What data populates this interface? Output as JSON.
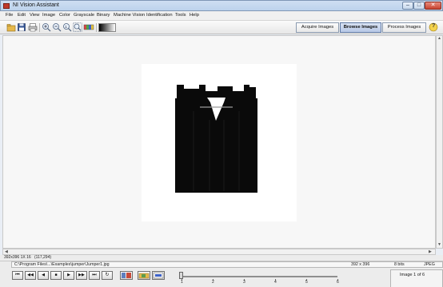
{
  "window": {
    "title": "NI Vision Assistant"
  },
  "menu": [
    "File",
    "Edit",
    "View",
    "Image",
    "Color",
    "Grayscale",
    "Binary",
    "Machine Vision",
    "Identification",
    "Tools",
    "Help"
  ],
  "tabs": {
    "acquire": "Acquire Images",
    "browse": "Browse Images",
    "process": "Process Images"
  },
  "toolbar": {
    "help_icon": "?"
  },
  "status": {
    "dims": "392x396 1X 16",
    "coords": "(117,294)"
  },
  "file": {
    "path": "C:\\Program Files\\...\\Examples\\jumper\\Jumper1.jpg",
    "dimensions": "392 x 396",
    "depth": "8 bits",
    "format": "JPEG",
    "page": "Image 1 of 6"
  },
  "player": {
    "first": "⏮",
    "rew": "◀◀",
    "prev": "◀",
    "stop": "■",
    "next": "▶",
    "ff": "▶▶",
    "last": "⏭",
    "loop": "↻"
  },
  "slider": {
    "value": 1,
    "ticks": [
      "1",
      "2",
      "3",
      "4",
      "5",
      "6"
    ]
  }
}
